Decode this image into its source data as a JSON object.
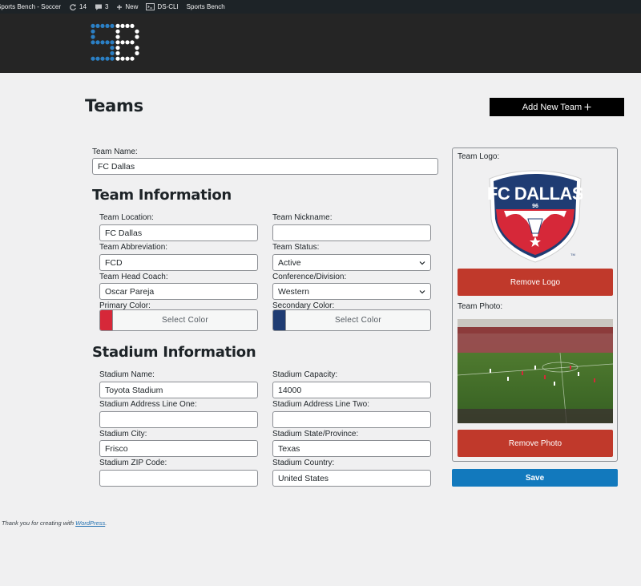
{
  "adminbar": {
    "site_name": "Sports Bench - Soccer",
    "updates_count": "14",
    "comments_count": "3",
    "new_label": "New",
    "dscli_label": "DS-CLI",
    "sports_bench_label": "Sports Bench"
  },
  "page": {
    "title": "Teams",
    "add_new_label": "Add New Team"
  },
  "form": {
    "team_name_label": "Team Name:",
    "team_name_value": "FC Dallas",
    "team_info_heading": "Team Information",
    "stadium_info_heading": "Stadium Information",
    "team_location_label": "Team Location:",
    "team_location_value": "FC Dallas",
    "team_nickname_label": "Team Nickname:",
    "team_nickname_value": "",
    "team_abbreviation_label": "Team Abbreviation:",
    "team_abbreviation_value": "FCD",
    "team_status_label": "Team Status:",
    "team_status_value": "Active",
    "team_head_coach_label": "Team Head Coach:",
    "team_head_coach_value": "Oscar Pareja",
    "conference_label": "Conference/Division:",
    "conference_value": "Western",
    "primary_color_label": "Primary Color:",
    "secondary_color_label": "Secondary Color:",
    "select_color_label": "Select Color",
    "stadium_name_label": "Stadium Name:",
    "stadium_name_value": "Toyota Stadium",
    "stadium_capacity_label": "Stadium Capacity:",
    "stadium_capacity_value": "14000",
    "stadium_address_one_label": "Stadium Address Line One:",
    "stadium_address_one_value": "",
    "stadium_address_two_label": "Stadium Address Line Two:",
    "stadium_address_two_value": "",
    "stadium_city_label": "Stadium City:",
    "stadium_city_value": "Frisco",
    "stadium_state_label": "Stadium State/Province:",
    "stadium_state_value": "Texas",
    "stadium_zip_label": "Stadium ZIP Code:",
    "stadium_zip_value": "",
    "stadium_country_label": "Stadium Country:",
    "stadium_country_value": "United States"
  },
  "side": {
    "team_logo_label": "Team Logo:",
    "remove_logo_label": "Remove Logo",
    "team_photo_label": "Team Photo:",
    "remove_photo_label": "Remove Photo",
    "save_label": "Save"
  },
  "logo_text": {
    "brand": "SB",
    "crest_name": "FC DALLAS",
    "crest_year": "96",
    "crest_tm": "TM"
  },
  "footer": {
    "text": "Thank you for creating with",
    "link": "WordPress",
    "end": "."
  },
  "colors": {
    "primary_swatch": "#d62839",
    "secondary_swatch": "#1f3c73",
    "remove_button": "#c0392b",
    "save_button": "#1279bd",
    "header_bg": "#252525",
    "adminbar_bg": "#1d2327"
  },
  "icons": {
    "updates": "refresh-icon",
    "comments": "comment-icon",
    "new": "plus-icon",
    "dscli": "terminal-icon",
    "add_new": "plus-icon",
    "select": "chevron-down-icon"
  }
}
